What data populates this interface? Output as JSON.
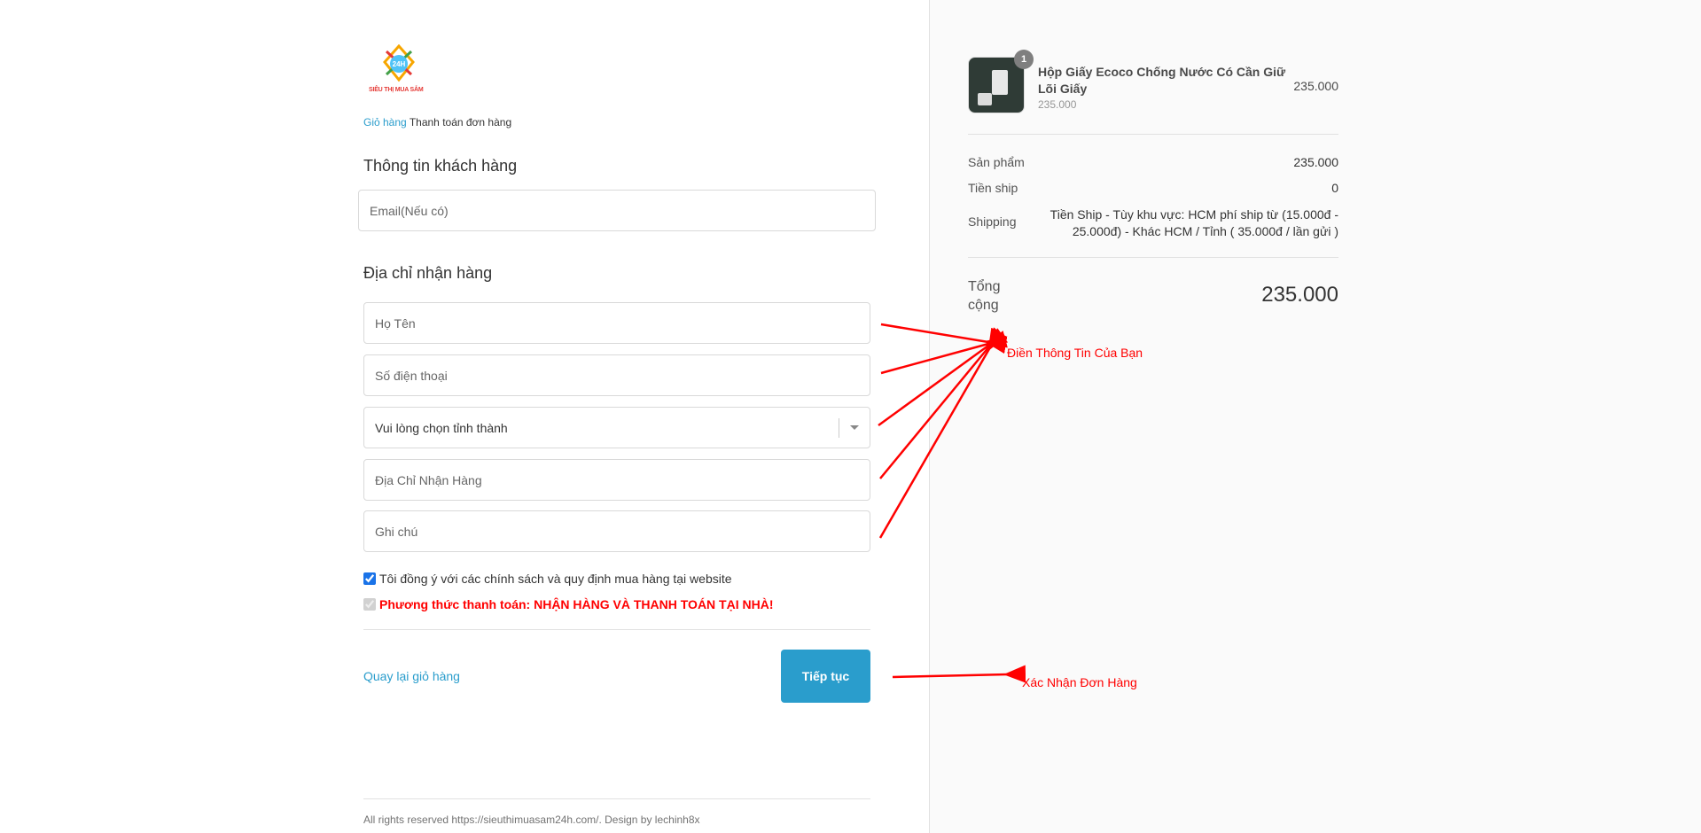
{
  "logo": {
    "text": "SIÊU THỊ MUA SẮM",
    "badge": "24H"
  },
  "breadcrumb": {
    "cart": "Giỏ hàng",
    "current": "Thanh toán đơn hàng"
  },
  "customer": {
    "title": "Thông tin khách hàng",
    "email_placeholder": "Email(Nếu có)"
  },
  "address": {
    "title": "Địa chỉ nhận hàng",
    "name_placeholder": "Họ Tên",
    "phone_placeholder": "Số điện thoại",
    "province_selected": "Vui lòng chọn tỉnh thành",
    "address_placeholder": "Địa Chỉ Nhận Hàng",
    "note_placeholder": "Ghi chú"
  },
  "agree": {
    "label": "Tôi đồng ý với các chính sách và quy định mua hàng tại website",
    "checked": true
  },
  "payment": {
    "label": "Phương thức thanh toán: NHẬN HÀNG VÀ THANH TOÁN TẠI NHÀ!"
  },
  "actions": {
    "back": "Quay lại giỏ hàng",
    "continue": "Tiếp tục"
  },
  "footer": {
    "text": "All rights reserved https://sieuthimuasam24h.com/. Design by lechinh8x"
  },
  "summary": {
    "product": {
      "name": "Hộp Giấy Ecoco Chống Nước Có Cần Giữ Lõi Giấy",
      "unit_price": "235.000",
      "price": "235.000",
      "quantity": "1"
    },
    "subtotal_label": "Sản phẩm",
    "subtotal": "235.000",
    "ship_fee_label": "Tiền ship",
    "ship_fee": "0",
    "shipping_label": "Shipping",
    "shipping": "Tiền Ship - Tùy khu vực: HCM phí ship từ (15.000đ - 25.000đ) - Khác HCM / Tỉnh ( 35.000đ / lần gửi )",
    "total_label": "Tổng cộng",
    "total": "235.000"
  },
  "annotations": {
    "fill_info": "Điền Thông Tin Của Bạn",
    "confirm": "Xác Nhận Đơn Hàng"
  },
  "colors": {
    "accent": "#2a9dcc",
    "annotation": "#ff0000"
  }
}
